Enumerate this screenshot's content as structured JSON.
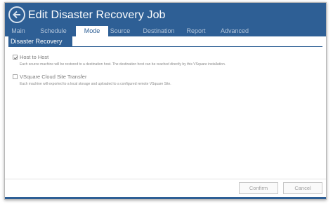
{
  "dialog": {
    "title": "Edit Disaster Recovery Job"
  },
  "tabs": [
    {
      "label": "Main"
    },
    {
      "label": "Schedule"
    },
    {
      "label": "Mode"
    },
    {
      "label": "Source"
    },
    {
      "label": "Destination"
    },
    {
      "label": "Report"
    },
    {
      "label": "Advanced"
    }
  ],
  "active_tab": "Mode",
  "section": {
    "title": "Disaster Recovery"
  },
  "options": [
    {
      "label": "Host to Host",
      "checked": true,
      "description": "Each source machine will be restored to a destination host. The destination host can be reached directly by this VSquare installation."
    },
    {
      "label": "VSquare Cloud Site Transfer",
      "checked": false,
      "description": "Each machine will exported to a local storage and uploaded to a configured remote VSquare Site."
    }
  ],
  "footer": {
    "confirm_label": "Confirm",
    "cancel_label": "Cancel"
  },
  "colors": {
    "accent": "#2e5f95",
    "tab_inactive": "#b3c5da"
  },
  "icons": {
    "back": "arrow-left-icon",
    "check": "checkmark-icon"
  }
}
